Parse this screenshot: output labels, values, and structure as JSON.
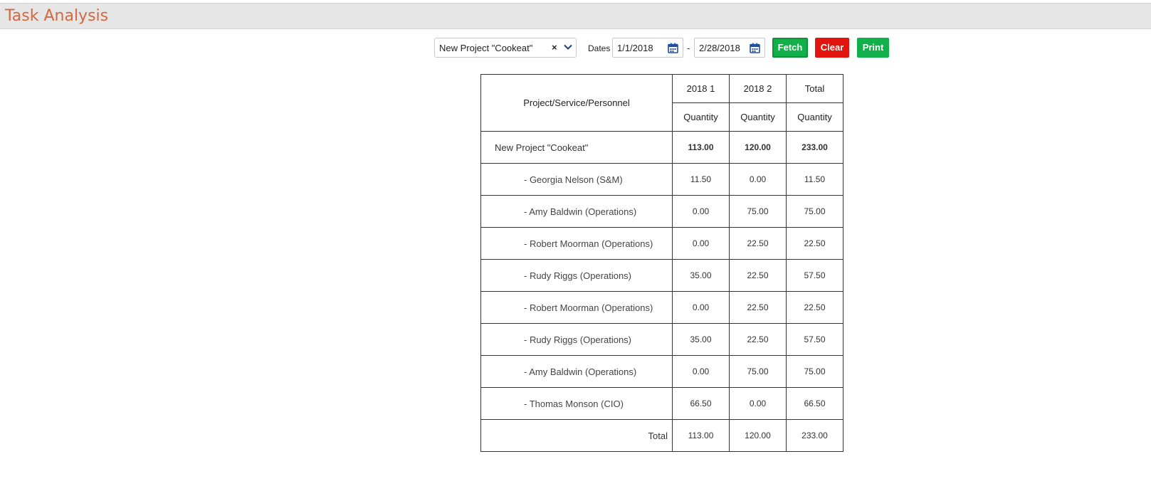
{
  "header": {
    "title": "Task Analysis"
  },
  "toolbar": {
    "project_value": "New Project \"Cookeat\"",
    "clear_symbol": "×",
    "dates_label": "Dates",
    "date_from": "1/1/2018",
    "date_separator": "-",
    "date_to": "2/28/2018",
    "fetch_label": "Fetch",
    "clear_label": "Clear",
    "print_label": "Print",
    "colors": {
      "fetch": "#12b04a",
      "clear": "#e1150d",
      "print": "#12b04a",
      "title": "#d2683f",
      "calendar_icon": "#1f4fa0"
    }
  },
  "table": {
    "header_name": "Project/Service/Personnel",
    "periods": [
      "2018 1",
      "2018 2",
      "Total"
    ],
    "subheader": "Quantity",
    "project_row": {
      "name": "New Project \"Cookeat\"",
      "values": [
        "113.00",
        "120.00",
        "233.00"
      ]
    },
    "rows": [
      {
        "name": "- Georgia Nelson (S&M)",
        "values": [
          "11.50",
          "0.00",
          "11.50"
        ]
      },
      {
        "name": "- Amy Baldwin (Operations)",
        "values": [
          "0.00",
          "75.00",
          "75.00"
        ]
      },
      {
        "name": "- Robert Moorman (Operations)",
        "values": [
          "0.00",
          "22.50",
          "22.50"
        ]
      },
      {
        "name": "- Rudy Riggs (Operations)",
        "values": [
          "35.00",
          "22.50",
          "57.50"
        ]
      },
      {
        "name": "- Robert Moorman (Operations)",
        "values": [
          "0.00",
          "22.50",
          "22.50"
        ]
      },
      {
        "name": "- Rudy Riggs (Operations)",
        "values": [
          "35.00",
          "22.50",
          "57.50"
        ]
      },
      {
        "name": "- Amy Baldwin (Operations)",
        "values": [
          "0.00",
          "75.00",
          "75.00"
        ]
      },
      {
        "name": "- Thomas Monson (CIO)",
        "values": [
          "66.50",
          "0.00",
          "66.50"
        ]
      }
    ],
    "total_row": {
      "label": "Total",
      "values": [
        "113.00",
        "120.00",
        "233.00"
      ]
    }
  }
}
